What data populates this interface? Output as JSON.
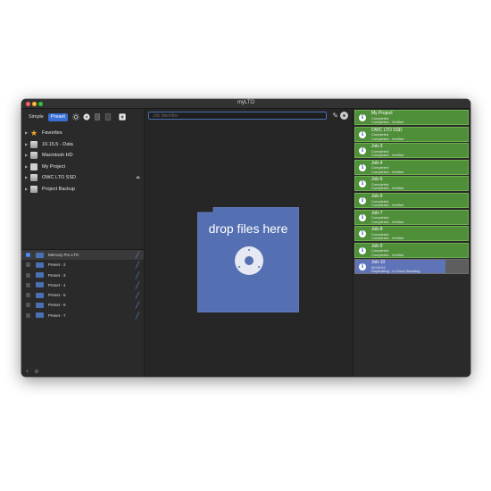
{
  "window": {
    "title": "myLTO"
  },
  "toolbar": {
    "simple_label": "Simple",
    "preset_label": "Preset"
  },
  "sidebar": {
    "items": [
      {
        "label": "Favorites",
        "icon": "star-icon",
        "eject": false
      },
      {
        "label": "10.15.5 - Data",
        "icon": "disk-icon",
        "eject": false
      },
      {
        "label": "Macintosh HD",
        "icon": "disk-icon",
        "eject": false
      },
      {
        "label": "My Project",
        "icon": "folder-icon",
        "eject": false
      },
      {
        "label": "OWC LTO SSD",
        "icon": "disk-icon",
        "eject": true
      },
      {
        "label": "Project Backup",
        "icon": "disk-icon",
        "eject": false
      }
    ]
  },
  "presets": [
    {
      "label": "Mercury Pro LTO",
      "checked": true
    },
    {
      "label": "Preset - 2",
      "checked": false
    },
    {
      "label": "Preset - 3",
      "checked": false
    },
    {
      "label": "Preset - 4",
      "checked": false
    },
    {
      "label": "Preset - 5",
      "checked": false
    },
    {
      "label": "Preset - 6",
      "checked": false
    },
    {
      "label": "Preset - 7",
      "checked": false
    }
  ],
  "footer": {
    "add_label": "+",
    "settings_label": "⚙"
  },
  "main": {
    "job_identifier_placeholder": "Job Identifier",
    "drop_text": "drop files here",
    "drop_color": "#5470b3"
  },
  "jobs": [
    {
      "title": "My Project",
      "line1": "Completed",
      "line2": "Completed - Verified",
      "status": "complete"
    },
    {
      "title": "OWC LTO SSD",
      "line1": "Completed",
      "line2": "Completed - Verified",
      "status": "complete"
    },
    {
      "title": "Job-3",
      "line1": "Completed",
      "line2": "Completed - Verified",
      "status": "complete"
    },
    {
      "title": "Job-4",
      "line1": "Completed",
      "line2": "Completed - Verified",
      "status": "complete"
    },
    {
      "title": "Job-5",
      "line1": "Completed",
      "line2": "Completed - Verified",
      "status": "complete"
    },
    {
      "title": "Job-6",
      "line1": "Completed",
      "line2": "Completed - Verified",
      "status": "complete"
    },
    {
      "title": "Job-7",
      "line1": "Completed",
      "line2": "Completed - Verified",
      "status": "complete"
    },
    {
      "title": "Job-8",
      "line1": "Completed",
      "line2": "Completed - Verified",
      "status": "complete"
    },
    {
      "title": "Job-9",
      "line1": "Completed",
      "line2": "Completed - Verified",
      "status": "complete"
    },
    {
      "title": "Job-10",
      "line1": "00:00:01",
      "line2": "Replicating - In Good Standing",
      "status": "active",
      "progress": 0.8
    }
  ],
  "colors": {
    "accent": "#3a6fd6",
    "job_complete": "#4f8f3a",
    "job_progress": "#5f73b8"
  }
}
